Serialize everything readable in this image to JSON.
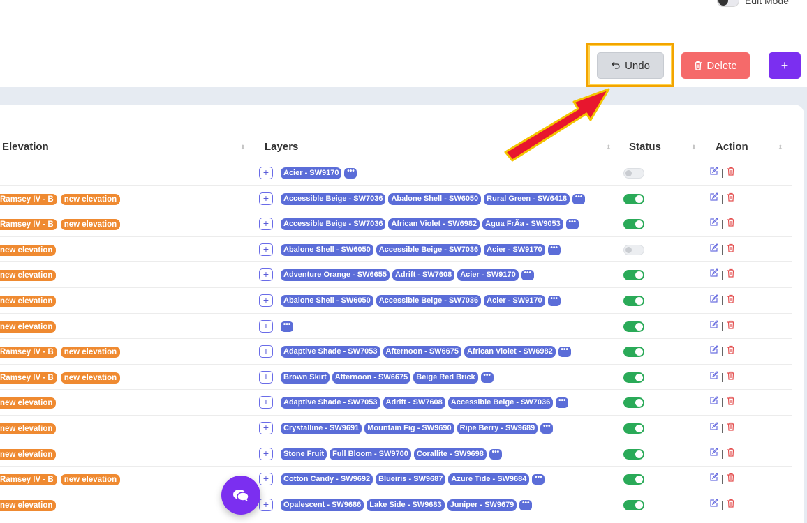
{
  "header": {
    "edit_mode_label": "Edit Mode"
  },
  "toolbar": {
    "undo_label": "Undo",
    "delete_label": "Delete",
    "add_label": "+"
  },
  "table": {
    "columns": {
      "elevation": "Elevation",
      "layers": "Layers",
      "status": "Status",
      "action": "Action"
    },
    "rows": [
      {
        "elevation": [],
        "layers": [
          "Acier - SW9170"
        ],
        "status": "off"
      },
      {
        "elevation": [
          "Ramsey IV - B",
          "new elevation"
        ],
        "layers": [
          "Accessible Beige - SW7036",
          "Abalone Shell - SW6050",
          "Rural Green - SW6418"
        ],
        "status": "on"
      },
      {
        "elevation": [
          "Ramsey IV - B",
          "new elevation"
        ],
        "layers": [
          "Accessible Beige - SW7036",
          "African Violet - SW6982",
          "Agua FrÃa - SW9053"
        ],
        "status": "on"
      },
      {
        "elevation": [
          "new elevation"
        ],
        "layers": [
          "Abalone Shell - SW6050",
          "Accessible Beige - SW7036",
          "Acier - SW9170"
        ],
        "status": "off"
      },
      {
        "elevation": [
          "new elevation"
        ],
        "layers": [
          "Adventure Orange - SW6655",
          "Adrift - SW7608",
          "Acier - SW9170"
        ],
        "status": "on"
      },
      {
        "elevation": [
          "new elevation"
        ],
        "layers": [
          "Abalone Shell - SW6050",
          "Accessible Beige - SW7036",
          "Acier - SW9170"
        ],
        "status": "on"
      },
      {
        "elevation": [
          "new elevation"
        ],
        "layers": [],
        "status": "on"
      },
      {
        "elevation": [
          "Ramsey IV - B",
          "new elevation"
        ],
        "layers": [
          "Adaptive Shade - SW7053",
          "Afternoon - SW6675",
          "African Violet - SW6982"
        ],
        "status": "on"
      },
      {
        "elevation": [
          "Ramsey IV - B",
          "new elevation"
        ],
        "layers": [
          "Brown Skirt",
          "Afternoon - SW6675",
          "Beige Red Brick"
        ],
        "status": "on"
      },
      {
        "elevation": [
          "new elevation"
        ],
        "layers": [
          "Adaptive Shade - SW7053",
          "Adrift - SW7608",
          "Accessible Beige - SW7036"
        ],
        "status": "on"
      },
      {
        "elevation": [
          "new elevation"
        ],
        "layers": [
          "Crystalline - SW9691",
          "Mountain Fig - SW9690",
          "Ripe Berry - SW9689"
        ],
        "status": "on"
      },
      {
        "elevation": [
          "new elevation"
        ],
        "layers": [
          "Stone Fruit",
          "Full Bloom - SW9700",
          "Corallite - SW9698"
        ],
        "status": "on"
      },
      {
        "elevation": [
          "Ramsey IV - B",
          "new elevation"
        ],
        "layers": [
          "Cotton Candy - SW9692",
          "Blueiris - SW9687",
          "Azure Tide - SW9684"
        ],
        "status": "on"
      },
      {
        "elevation": [
          "new elevation"
        ],
        "layers": [
          "Opalescent - SW9686",
          "Lake Side - SW9683",
          "Juniper - SW9679"
        ],
        "status": "on"
      }
    ],
    "more_label": "•••",
    "plus_label": "+",
    "separator": "|"
  },
  "colors": {
    "accent": "#7b2ff0",
    "delete": "#f56a6a",
    "tag_orange": "#ef8a31",
    "tag_blue": "#5b6dd8",
    "status_on": "#2aaa58",
    "highlight": "#f3a400"
  }
}
